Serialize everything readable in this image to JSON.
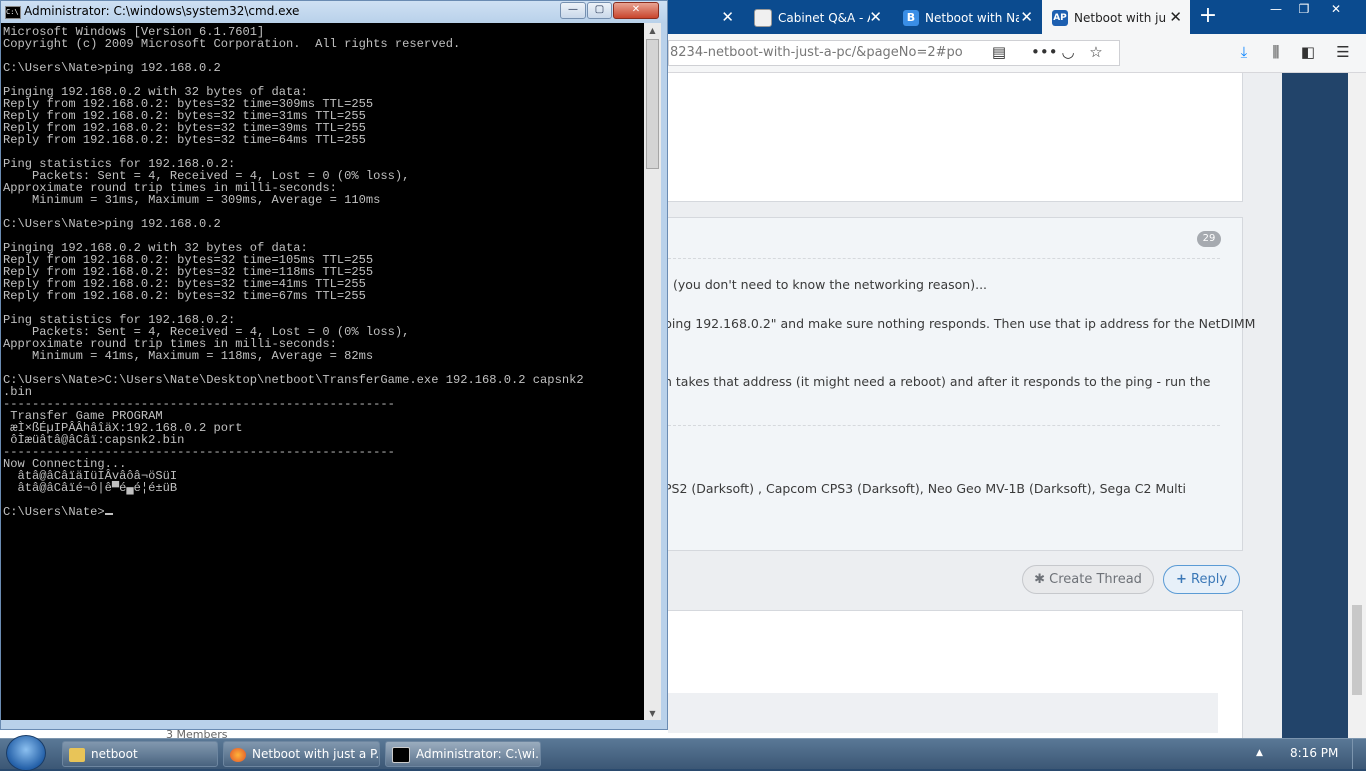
{
  "cmd": {
    "title": "Administrator: C:\\windows\\system32\\cmd.exe",
    "icon_text": "C:\\",
    "minimize_glyph": "—",
    "maximize_glyph": "▢",
    "close_glyph": "✕",
    "lines": [
      "Microsoft Windows [Version 6.1.7601]",
      "Copyright (c) 2009 Microsoft Corporation.  All rights reserved.",
      "",
      "C:\\Users\\Nate>ping 192.168.0.2",
      "",
      "Pinging 192.168.0.2 with 32 bytes of data:",
      "Reply from 192.168.0.2: bytes=32 time=309ms TTL=255",
      "Reply from 192.168.0.2: bytes=32 time=31ms TTL=255",
      "Reply from 192.168.0.2: bytes=32 time=39ms TTL=255",
      "Reply from 192.168.0.2: bytes=32 time=64ms TTL=255",
      "",
      "Ping statistics for 192.168.0.2:",
      "    Packets: Sent = 4, Received = 4, Lost = 0 (0% loss),",
      "Approximate round trip times in milli-seconds:",
      "    Minimum = 31ms, Maximum = 309ms, Average = 110ms",
      "",
      "C:\\Users\\Nate>ping 192.168.0.2",
      "",
      "Pinging 192.168.0.2 with 32 bytes of data:",
      "Reply from 192.168.0.2: bytes=32 time=105ms TTL=255",
      "Reply from 192.168.0.2: bytes=32 time=118ms TTL=255",
      "Reply from 192.168.0.2: bytes=32 time=41ms TTL=255",
      "Reply from 192.168.0.2: bytes=32 time=67ms TTL=255",
      "",
      "Ping statistics for 192.168.0.2:",
      "    Packets: Sent = 4, Received = 4, Lost = 0 (0% loss),",
      "Approximate round trip times in milli-seconds:",
      "    Minimum = 41ms, Maximum = 118ms, Average = 82ms",
      "",
      "C:\\Users\\Nate>C:\\Users\\Nate\\Desktop\\netboot\\TransferGame.exe 192.168.0.2 capsnk2",
      ".bin",
      "------------------------------------------------------",
      " Transfer Game PROGRAM",
      " æÌ×ßÉµIPÂÂhâîäX:192.168.0.2 port",
      " ôÌæüâtâ@âCâï:capsnk2.bin",
      "------------------------------------------------------",
      "Now Connecting...",
      "  âtâ@âCâïäIüIÂvâôâ¬öSüI",
      "  âtâ@âCâïé¬ô|ê▀é▄é¦é±üB",
      "",
      "C:\\Users\\Nate>"
    ]
  },
  "browser": {
    "tabs": [
      {
        "label": "Cabinet Q&A - A",
        "icon": "document-icon"
      },
      {
        "label": "Netboot with Na",
        "icon": "forum-b-icon"
      },
      {
        "label": "Netboot with jus",
        "icon": "arcade-projects-icon",
        "active": true
      }
    ],
    "url": "8234-netboot-with-just-a-pc/&pageNo=2#po",
    "post_badge": "29",
    "post_lines": [
      "(you don't need to know the networking reason)...",
      "ping 192.168.0.2\" and make sure nothing responds. Then use that ip address for the NetDIMM",
      "n takes that address (it might need a reboot) and after it responds to the ping - run the",
      "PS2 (Darksoft) , Capcom CPS3 (Darksoft), Neo Geo MV-1B (Darksoft), Sega C2 Multi"
    ],
    "create_thread_label": "Create Thread",
    "reply_label": "Reply",
    "members_text": "3 Members"
  },
  "taskbar": {
    "items": [
      {
        "label": "netboot",
        "icon": "folder-icon"
      },
      {
        "label": "Netboot with just a P...",
        "icon": "firefox-icon"
      },
      {
        "label": "Administrator: C:\\wi...",
        "icon": "cmd-icon",
        "active": true
      }
    ],
    "clock": "8:16 PM",
    "tray_arrow": "▲"
  },
  "colors": {
    "console_bg": "#000000",
    "console_fg": "#c0c0c0",
    "browser_tabstrip": "#0b4b8f",
    "reply_accent": "#3b78b7",
    "taskbar": "#3c5775"
  }
}
